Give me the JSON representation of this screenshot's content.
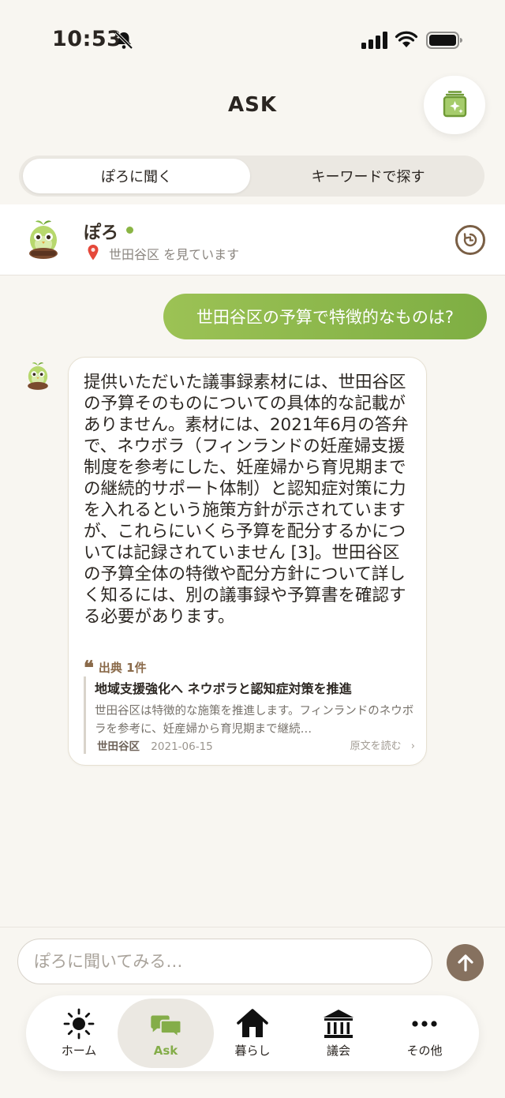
{
  "status_bar": {
    "time": "10:53"
  },
  "header": {
    "title": "ASK"
  },
  "segments": [
    {
      "label": "ぽろに聞く",
      "active": true
    },
    {
      "label": "キーワードで探す",
      "active": false
    }
  ],
  "bot": {
    "name": "ぽろ",
    "location": "世田谷区 を見ています",
    "status_color": "#8ab544"
  },
  "conversation": {
    "user_message": "世田谷区の予算で特徴的なものは?",
    "bot_message": "提供いただいた議事録素材には、世田谷区の予算そのものについての具体的な記載がありません。素材には、2021年6月の答弁で、ネウボラ（フィンランドの妊産婦支援制度を参考にした、妊産婦から育児期までの継続的サポート体制）と認知症対策に力を入れるという施策方針が示されていますが、これらにいくら予算を配分するかについては記録されていません [3]。世田谷区の予算全体の特徴や配分方針について詳しく知るには、別の議事録や予算書を確認する必要があります。",
    "sources_label": "出典 1件",
    "source": {
      "title": "地域支援強化へ ネウボラと認知症対策を推進",
      "snippet": "世田谷区は特徴的な施策を推進します。フィンランドのネウボラを参考に、妊産婦から育児期まで継続…",
      "ward": "世田谷区",
      "date": "2021-06-15",
      "read_label": "原文を読む"
    }
  },
  "input": {
    "placeholder": "ぽろに聞いてみる…",
    "value": ""
  },
  "tabs": [
    {
      "label": "ホーム",
      "icon": "sun-icon"
    },
    {
      "label": "Ask",
      "icon": "chat-bubbles-icon",
      "active": true
    },
    {
      "label": "暮らし",
      "icon": "house-icon"
    },
    {
      "label": "議会",
      "icon": "assembly-building-icon"
    },
    {
      "label": "その他",
      "icon": "more-dots-icon"
    }
  ],
  "colors": {
    "accent_green": "#84ad49",
    "brown": "#86715f",
    "background": "#f8f6f1"
  }
}
